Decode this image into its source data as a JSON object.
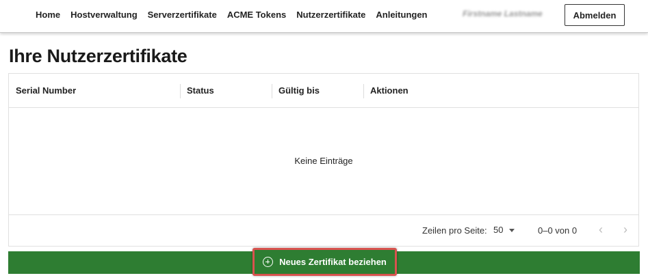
{
  "nav": {
    "links": [
      "Home",
      "Hostverwaltung",
      "Serverzertifikate",
      "ACME Tokens",
      "Nutzerzertifikate",
      "Anleitungen"
    ],
    "user_name": "Firstname Lastname",
    "logout_label": "Abmelden"
  },
  "page": {
    "title": "Ihre Nutzerzertifikate"
  },
  "table": {
    "columns": [
      "Serial Number",
      "Status",
      "Gültig bis",
      "Aktionen"
    ],
    "empty_message": "Keine Einträge"
  },
  "pagination": {
    "rows_per_page_label": "Zeilen pro Seite:",
    "rows_per_page_value": "50",
    "range_text": "0–0 von 0",
    "prev_icon": "chevron-left-icon",
    "next_icon": "chevron-right-icon"
  },
  "actions": {
    "new_cert_label": "Neues Zertifikat beziehen",
    "new_cert_icon": "add-circle-icon"
  },
  "colors": {
    "accent_green": "#2e7d32",
    "highlight_red": "#d9534f"
  }
}
